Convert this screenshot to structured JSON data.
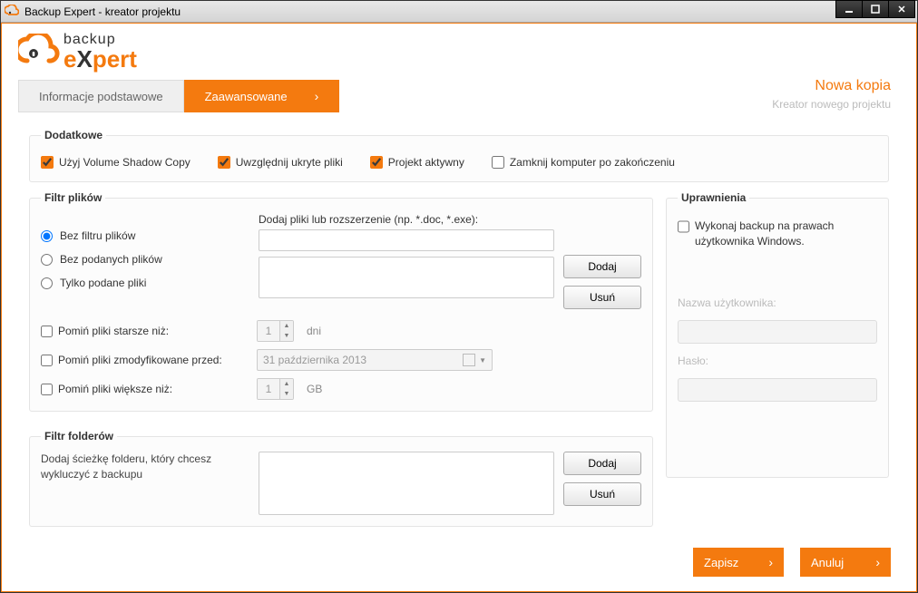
{
  "window": {
    "title": "Backup Expert - kreator projektu"
  },
  "logo": {
    "text1": "backup",
    "text2": "e",
    "text3": "X",
    "text4": "pert"
  },
  "tabs": {
    "basic": "Informacje podstawowe",
    "advanced": "Zaawansowane"
  },
  "header": {
    "new_copy": "Nowa kopia",
    "subtitle": "Kreator nowego projektu"
  },
  "extras": {
    "legend": "Dodatkowe",
    "vss": "Użyj Volume Shadow Copy",
    "hidden": "Uwzględnij ukryte pliki",
    "active": "Projekt aktywny",
    "shutdown": "Zamknij komputer po zakończeniu"
  },
  "file_filter": {
    "legend": "Filtr plików",
    "r_none": "Bez filtru plików",
    "r_without": "Bez podanych plików",
    "r_only": "Tylko podane pliki",
    "add_label": "Dodaj pliki lub rozszerzenie (np. *.doc, *.exe):",
    "btn_add": "Dodaj",
    "btn_del": "Usuń",
    "skip_older": "Pomiń pliki starsze niż:",
    "skip_older_val": "1",
    "skip_older_unit": "dni",
    "skip_mod": "Pomiń pliki zmodyfikowane przed:",
    "skip_mod_date": "31 października 2013",
    "skip_big": "Pomiń pliki większe niż:",
    "skip_big_val": "1",
    "skip_big_unit": "GB"
  },
  "folder_filter": {
    "legend": "Filtr folderów",
    "desc": "Dodaj ścieżkę folderu, który chcesz wykluczyć z backupu",
    "btn_add": "Dodaj",
    "btn_del": "Usuń"
  },
  "perms": {
    "legend": "Uprawnienia",
    "run_as": "Wykonaj backup na prawach użytkownika Windows.",
    "user_lbl": "Nazwa użytkownika:",
    "pass_lbl": "Hasło:"
  },
  "footer": {
    "save": "Zapisz",
    "cancel": "Anuluj"
  }
}
